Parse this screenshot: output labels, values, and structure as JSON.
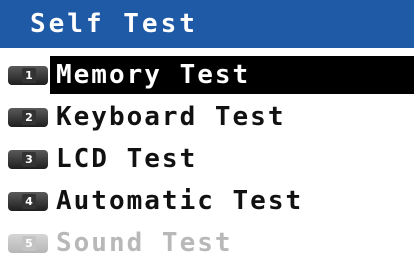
{
  "title": "Self Test",
  "menu": {
    "items": [
      {
        "number": "1",
        "label": "Memory Test",
        "selected": true,
        "enabled": true
      },
      {
        "number": "2",
        "label": "Keyboard Test",
        "selected": false,
        "enabled": true
      },
      {
        "number": "3",
        "label": "LCD Test",
        "selected": false,
        "enabled": true
      },
      {
        "number": "4",
        "label": "Automatic Test",
        "selected": false,
        "enabled": true
      },
      {
        "number": "5",
        "label": "Sound Test",
        "selected": false,
        "enabled": false
      }
    ]
  },
  "colors": {
    "title_bar": "#1f5aa6",
    "highlight": "#000000",
    "disabled_text": "#b8b8b8"
  }
}
